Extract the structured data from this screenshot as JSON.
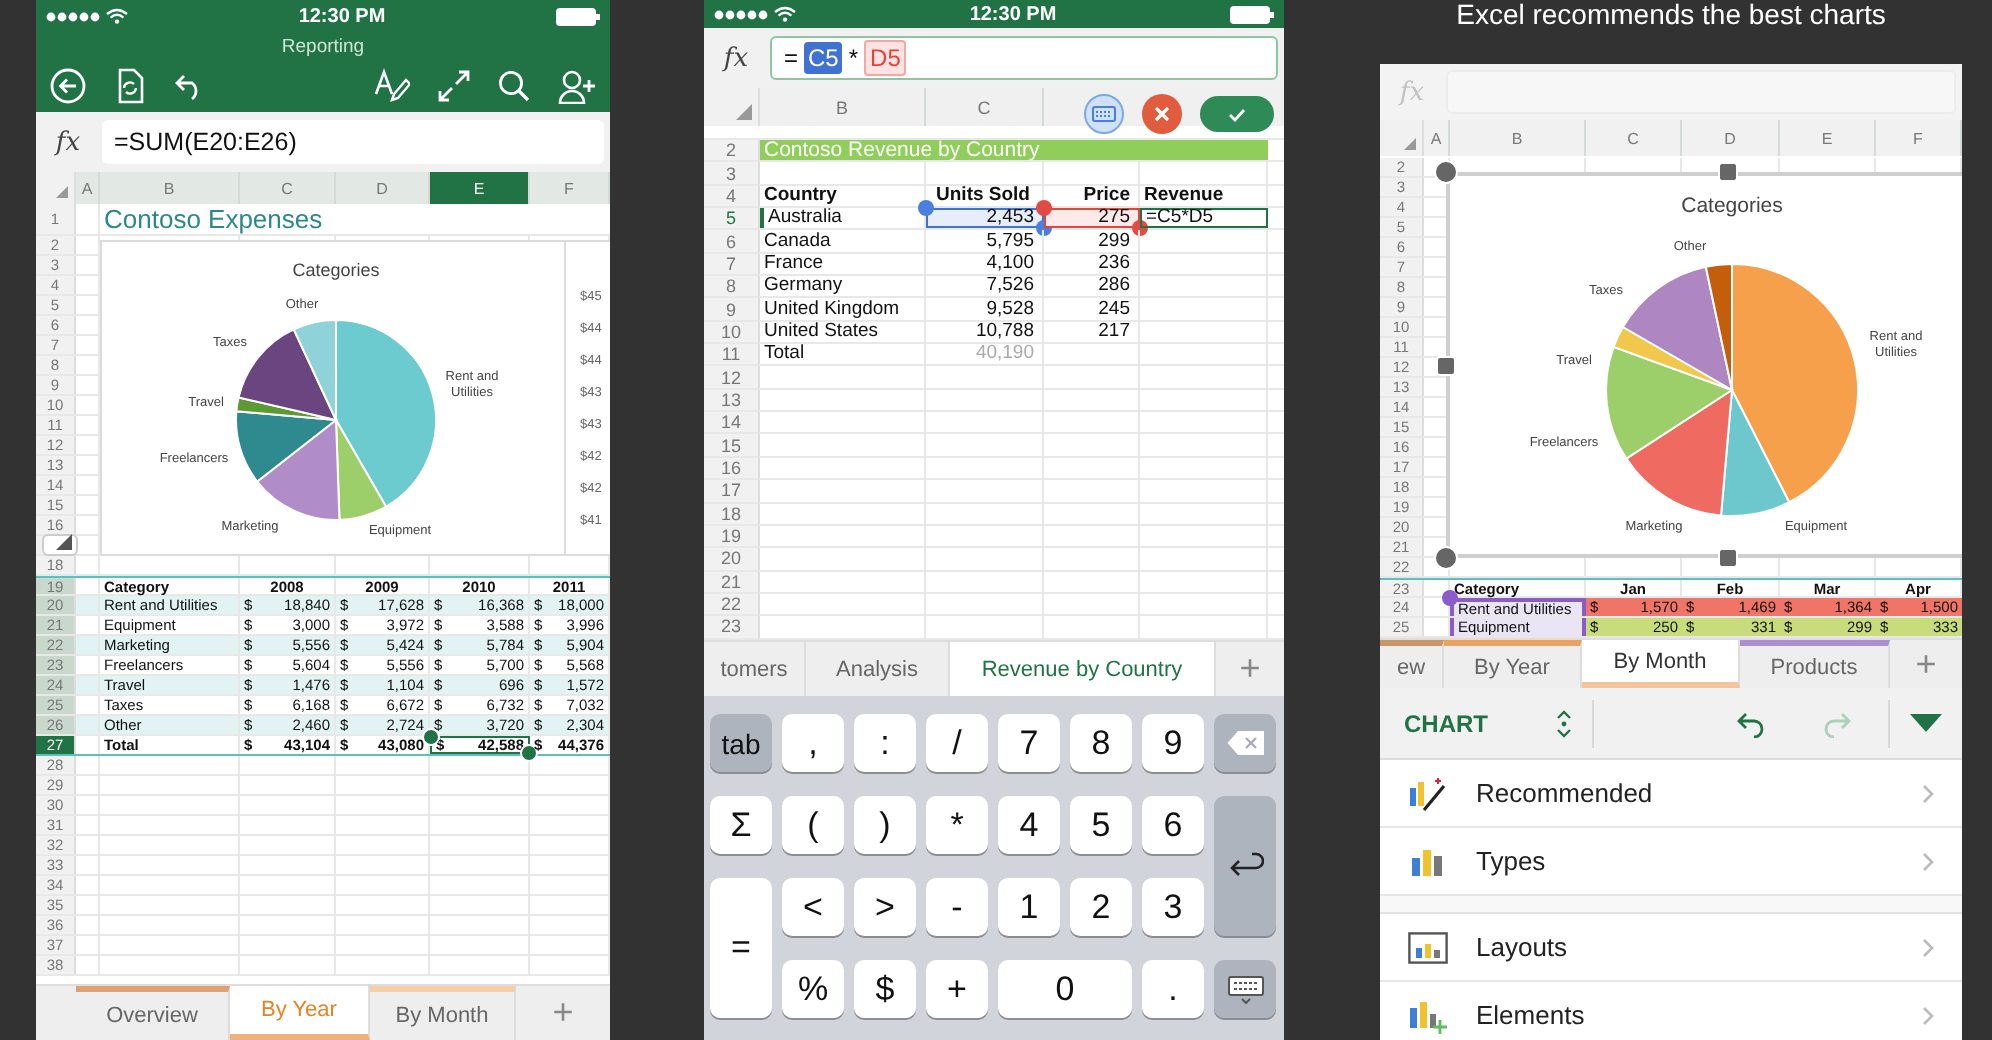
{
  "reporting": {
    "status_bar": {
      "time": "12:30 PM"
    },
    "title": "Reporting",
    "formula_bar": {
      "label": "fx",
      "value": "=SUM(E20:E26)"
    },
    "columns": [
      {
        "label": "A",
        "selected": false
      },
      {
        "label": "B",
        "selected": false
      },
      {
        "label": "C",
        "selected": false
      },
      {
        "label": "D",
        "selected": false
      },
      {
        "label": "E",
        "selected": true
      },
      {
        "label": "F",
        "selected": false
      }
    ],
    "rows": [
      {
        "number": "1",
        "selected": false,
        "highlighted": false,
        "kind": "title",
        "text": "Contoso Expenses"
      },
      {
        "number": "2",
        "selected": false,
        "highlighted": false,
        "kind": "blank"
      },
      {
        "number": "3",
        "selected": false,
        "highlighted": false,
        "kind": "blank"
      },
      {
        "number": "4",
        "selected": false,
        "highlighted": false,
        "kind": "blank"
      },
      {
        "number": "5",
        "selected": false,
        "highlighted": false,
        "kind": "blank"
      },
      {
        "number": "6",
        "selected": false,
        "highlighted": false,
        "kind": "blank"
      },
      {
        "number": "7",
        "selected": false,
        "highlighted": false,
        "kind": "blank"
      },
      {
        "number": "8",
        "selected": false,
        "highlighted": false,
        "kind": "blank"
      },
      {
        "number": "9",
        "selected": false,
        "highlighted": false,
        "kind": "blank"
      },
      {
        "number": "10",
        "selected": false,
        "highlighted": false,
        "kind": "blank"
      },
      {
        "number": "11",
        "selected": false,
        "highlighted": false,
        "kind": "blank"
      },
      {
        "number": "12",
        "selected": false,
        "highlighted": false,
        "kind": "blank"
      },
      {
        "number": "13",
        "selected": false,
        "highlighted": false,
        "kind": "blank"
      },
      {
        "number": "14",
        "selected": false,
        "highlighted": false,
        "kind": "blank"
      },
      {
        "number": "15",
        "selected": false,
        "highlighted": false,
        "kind": "blank"
      },
      {
        "number": "16",
        "selected": false,
        "highlighted": false,
        "kind": "blank"
      },
      {
        "selected": false,
        "highlighted": false,
        "kind": "blank"
      },
      {
        "number": "18",
        "selected": false,
        "highlighted": false,
        "kind": "blank"
      },
      {
        "number": "19",
        "selected": false,
        "highlighted": true,
        "kind": "header",
        "category": "Category",
        "headings": [
          "2008",
          "2009",
          "2010",
          "2011"
        ]
      },
      {
        "number": "20",
        "selected": false,
        "highlighted": true,
        "kind": "data",
        "category": "Rent and Utilities",
        "values": [
          {
            "sign": "$",
            "amount": "18,840",
            "selected": false
          },
          {
            "sign": "$",
            "amount": "17,628",
            "selected": false
          },
          {
            "sign": "$",
            "amount": "16,368",
            "selected": false
          },
          {
            "sign": "$",
            "amount": "18,000",
            "selected": false
          }
        ]
      },
      {
        "number": "21",
        "selected": false,
        "highlighted": true,
        "kind": "data",
        "category": "Equipment",
        "values": [
          {
            "sign": "$",
            "amount": "3,000",
            "selected": false
          },
          {
            "sign": "$",
            "amount": "3,972",
            "selected": false
          },
          {
            "sign": "$",
            "amount": "3,588",
            "selected": false
          },
          {
            "sign": "$",
            "amount": "3,996",
            "selected": false
          }
        ]
      },
      {
        "number": "22",
        "selected": false,
        "highlighted": true,
        "kind": "data",
        "category": "Marketing",
        "values": [
          {
            "sign": "$",
            "amount": "5,556",
            "selected": false
          },
          {
            "sign": "$",
            "amount": "5,424",
            "selected": false
          },
          {
            "sign": "$",
            "amount": "5,784",
            "selected": false
          },
          {
            "sign": "$",
            "amount": "5,904",
            "selected": false
          }
        ]
      },
      {
        "number": "23",
        "selected": false,
        "highlighted": true,
        "kind": "data",
        "category": "Freelancers",
        "values": [
          {
            "sign": "$",
            "amount": "5,604",
            "selected": false
          },
          {
            "sign": "$",
            "amount": "5,556",
            "selected": false
          },
          {
            "sign": "$",
            "amount": "5,700",
            "selected": false
          },
          {
            "sign": "$",
            "amount": "5,568",
            "selected": false
          }
        ]
      },
      {
        "number": "24",
        "selected": false,
        "highlighted": true,
        "kind": "data",
        "category": "Travel",
        "values": [
          {
            "sign": "$",
            "amount": "1,476",
            "selected": false
          },
          {
            "sign": "$",
            "amount": "1,104",
            "selected": false
          },
          {
            "sign": "$",
            "amount": "696",
            "selected": false
          },
          {
            "sign": "$",
            "amount": "1,572",
            "selected": false
          }
        ]
      },
      {
        "number": "25",
        "selected": false,
        "highlighted": true,
        "kind": "data",
        "category": "Taxes",
        "values": [
          {
            "sign": "$",
            "amount": "6,168",
            "selected": false
          },
          {
            "sign": "$",
            "amount": "6,672",
            "selected": false
          },
          {
            "sign": "$",
            "amount": "6,732",
            "selected": false
          },
          {
            "sign": "$",
            "amount": "7,032",
            "selected": false
          }
        ]
      },
      {
        "number": "26",
        "selected": false,
        "highlighted": true,
        "kind": "data",
        "category": "Other",
        "values": [
          {
            "sign": "$",
            "amount": "2,460",
            "selected": false
          },
          {
            "sign": "$",
            "amount": "2,724",
            "selected": false
          },
          {
            "sign": "$",
            "amount": "3,720",
            "selected": false
          },
          {
            "sign": "$",
            "amount": "2,304",
            "selected": false
          }
        ]
      },
      {
        "number": "27",
        "selected": true,
        "highlighted": false,
        "kind": "total",
        "category": "Total",
        "values": [
          {
            "sign": "$",
            "amount": "43,104",
            "selected": false
          },
          {
            "sign": "$",
            "amount": "43,080",
            "selected": false
          },
          {
            "sign": "$",
            "amount": "42,588",
            "selected": true
          },
          {
            "sign": "$",
            "amount": "44,376",
            "selected": false
          }
        ]
      },
      {
        "number": "28",
        "selected": false,
        "highlighted": false,
        "kind": "blank"
      },
      {
        "number": "29",
        "selected": false,
        "highlighted": false,
        "kind": "blank"
      },
      {
        "number": "30",
        "selected": false,
        "highlighted": false,
        "kind": "blank"
      },
      {
        "number": "31",
        "selected": false,
        "highlighted": false,
        "kind": "blank"
      },
      {
        "number": "32",
        "selected": false,
        "highlighted": false,
        "kind": "blank"
      },
      {
        "number": "33",
        "selected": false,
        "highlighted": false,
        "kind": "blank"
      },
      {
        "number": "34",
        "selected": false,
        "highlighted": false,
        "kind": "blank"
      },
      {
        "number": "35",
        "selected": false,
        "highlighted": false,
        "kind": "blank"
      },
      {
        "number": "36",
        "selected": false,
        "highlighted": false,
        "kind": "blank"
      },
      {
        "number": "37",
        "selected": false,
        "highlighted": false,
        "kind": "blank"
      },
      {
        "number": "38",
        "selected": false,
        "highlighted": false,
        "kind": "blank"
      }
    ],
    "chart": {
      "title": "Categories",
      "slices": [
        {
          "label": "Rent and Utilities",
          "color": "#6ccbcf"
        },
        {
          "label": "Equipment",
          "color": "#9ccf6a"
        },
        {
          "label": "Marketing",
          "color": "#b08cc8"
        },
        {
          "label": "Freelancers",
          "color": "#2e8a8f"
        },
        {
          "label": "Travel",
          "color": "#5c9a35"
        },
        {
          "label": "Taxes",
          "color": "#6a4580"
        },
        {
          "label": "Other",
          "color": "#8fd3d8"
        }
      ]
    },
    "side_chart": {
      "labels": [
        "$45",
        "$44",
        "$44",
        "$43",
        "$43",
        "$42",
        "$42",
        "$41"
      ]
    },
    "tabs": [
      {
        "label": "Overview",
        "selected": false,
        "color": "#e0a070"
      },
      {
        "label": "By Year",
        "selected": true,
        "color": "#f0b27c"
      },
      {
        "label": "By Month",
        "selected": false,
        "color": "#f6cfa8"
      }
    ],
    "add_tab": "+"
  },
  "formula_entry": {
    "status_bar": {
      "time": "12:30 PM"
    },
    "formula_bar": {
      "label": "fx",
      "formula": [
        {
          "text": "=",
          "kind": "plain"
        },
        {
          "text": "C5",
          "kind": "ref1"
        },
        {
          "text": "*",
          "kind": "plain"
        },
        {
          "text": "D5",
          "kind": "ref2"
        }
      ]
    },
    "columns": [
      "B",
      "C"
    ],
    "rows": [
      {
        "number": "2",
        "selected": false,
        "kind": "title",
        "cells": [
          "Contoso Revenue by Country"
        ]
      },
      {
        "number": "3",
        "selected": false,
        "kind": "blank"
      },
      {
        "number": "4",
        "selected": false,
        "kind": "header",
        "cells": [
          "Country",
          "Units Sold",
          "Price",
          "Revenue"
        ]
      },
      {
        "number": "5",
        "selected": true,
        "kind": "editing",
        "cells": [
          "Australia",
          "2,453",
          "275",
          "=C5*D5"
        ]
      },
      {
        "number": "6",
        "selected": false,
        "kind": "data",
        "cells": [
          "Canada",
          "5,795",
          "299"
        ]
      },
      {
        "number": "7",
        "selected": false,
        "kind": "data",
        "cells": [
          "France",
          "4,100",
          "236"
        ]
      },
      {
        "number": "8",
        "selected": false,
        "kind": "data",
        "cells": [
          "Germany",
          "7,526",
          "286"
        ]
      },
      {
        "number": "9",
        "selected": false,
        "kind": "data",
        "cells": [
          "United Kingdom",
          "9,528",
          "245"
        ]
      },
      {
        "number": "10",
        "selected": false,
        "kind": "data",
        "cells": [
          "United States",
          "10,788",
          "217"
        ]
      },
      {
        "number": "11",
        "selected": false,
        "kind": "total",
        "cells": [
          "Total",
          "40,190"
        ]
      },
      {
        "number": "12",
        "selected": false,
        "kind": "blank"
      },
      {
        "number": "13",
        "selected": false,
        "kind": "blank"
      },
      {
        "number": "14",
        "selected": false,
        "kind": "blank"
      },
      {
        "number": "15",
        "selected": false,
        "kind": "blank"
      },
      {
        "number": "16",
        "selected": false,
        "kind": "blank"
      },
      {
        "number": "17",
        "selected": false,
        "kind": "blank"
      },
      {
        "number": "18",
        "selected": false,
        "kind": "blank"
      },
      {
        "number": "19",
        "selected": false,
        "kind": "blank"
      },
      {
        "number": "20",
        "selected": false,
        "kind": "blank"
      },
      {
        "number": "21",
        "selected": false,
        "kind": "blank"
      },
      {
        "number": "22",
        "selected": false,
        "kind": "blank"
      },
      {
        "number": "23",
        "selected": false,
        "kind": "blank"
      }
    ],
    "tabs": [
      {
        "label": "tomers",
        "selected": false
      },
      {
        "label": "Analysis",
        "selected": false
      },
      {
        "label": "Revenue by Country",
        "selected": true
      }
    ],
    "add_tab": "+",
    "keys": [
      {
        "label": "tab",
        "kind": "tab"
      },
      {
        "label": ",",
        "kind": "key"
      },
      {
        "label": ":",
        "kind": "key"
      },
      {
        "label": "/",
        "kind": "key"
      },
      {
        "label": "7",
        "kind": "key"
      },
      {
        "label": "8",
        "kind": "key"
      },
      {
        "label": "9",
        "kind": "key"
      },
      {
        "kind": "delete"
      },
      {
        "label": "Σ",
        "kind": "key"
      },
      {
        "label": "(",
        "kind": "key"
      },
      {
        "label": ")",
        "kind": "key"
      },
      {
        "label": "*",
        "kind": "key"
      },
      {
        "label": "4",
        "kind": "key"
      },
      {
        "label": "5",
        "kind": "key"
      },
      {
        "label": "6",
        "kind": "key"
      },
      {
        "kind": "return"
      },
      {
        "label": "=",
        "kind": "tall"
      },
      {
        "label": "<",
        "kind": "key"
      },
      {
        "label": ">",
        "kind": "key"
      },
      {
        "label": "-",
        "kind": "key"
      },
      {
        "label": "1",
        "kind": "key"
      },
      {
        "label": "2",
        "kind": "key"
      },
      {
        "label": "3",
        "kind": "key"
      },
      {
        "label": "%",
        "kind": "key"
      },
      {
        "label": "$",
        "kind": "key"
      },
      {
        "label": "+",
        "kind": "key"
      },
      {
        "label": "0",
        "kind": "wide"
      },
      {
        "label": ".",
        "kind": "key"
      },
      {
        "kind": "hide"
      }
    ]
  },
  "chart_screen": {
    "caption": "Excel recommends the best charts",
    "formula_bar": {
      "label": "fx",
      "disabled": true
    },
    "columns": [
      "A",
      "B",
      "C",
      "D",
      "E",
      "F"
    ],
    "rows": [
      {
        "number": "2",
        "kind": "blank"
      },
      {
        "number": "3",
        "kind": "blank"
      },
      {
        "number": "4",
        "kind": "blank"
      },
      {
        "number": "5",
        "kind": "blank"
      },
      {
        "number": "6",
        "kind": "blank"
      },
      {
        "number": "7",
        "kind": "blank"
      },
      {
        "number": "8",
        "kind": "blank"
      },
      {
        "number": "9",
        "kind": "blank"
      },
      {
        "number": "10",
        "kind": "blank"
      },
      {
        "number": "11",
        "kind": "blank"
      },
      {
        "number": "12",
        "kind": "blank"
      },
      {
        "number": "13",
        "kind": "blank"
      },
      {
        "number": "14",
        "kind": "blank"
      },
      {
        "number": "15",
        "kind": "blank"
      },
      {
        "number": "16",
        "kind": "blank"
      },
      {
        "number": "17",
        "kind": "blank"
      },
      {
        "number": "18",
        "kind": "blank"
      },
      {
        "number": "19",
        "kind": "blank"
      },
      {
        "number": "20",
        "kind": "blank"
      },
      {
        "number": "21",
        "kind": "blank"
      },
      {
        "number": "22",
        "kind": "blank"
      },
      {
        "number": "23",
        "kind": "header",
        "category": "Category",
        "headings": [
          "Jan",
          "Feb",
          "Mar",
          "Apr"
        ]
      },
      {
        "number": "24",
        "kind": "data",
        "category": "Rent and Utilities",
        "selected": true,
        "color": "#f07468",
        "values": [
          {
            "sign": "$",
            "amount": "1,570"
          },
          {
            "sign": "$",
            "amount": "1,469"
          },
          {
            "sign": "$",
            "amount": "1,364"
          },
          {
            "sign": "$",
            "amount": "1,500"
          }
        ]
      },
      {
        "number": "25",
        "kind": "data",
        "category": "Equipment",
        "selected": true,
        "color": "#c9dc7c",
        "values": [
          {
            "sign": "$",
            "amount": "250"
          },
          {
            "sign": "$",
            "amount": "331"
          },
          {
            "sign": "$",
            "amount": "299"
          },
          {
            "sign": "$",
            "amount": "333"
          }
        ]
      }
    ],
    "chart": {
      "title": "Categories",
      "slices": [
        {
          "label": "Rent and Utilities",
          "color": "#f7a04b"
        },
        {
          "label": "Equipment",
          "color": "#6cc8cc"
        },
        {
          "label": "Marketing",
          "color": "#ef6b62"
        },
        {
          "label": "Freelancers",
          "color": "#9ccf6a"
        },
        {
          "label": "Travel",
          "color": "#f1c84c"
        },
        {
          "label": "Taxes",
          "color": "#ad86c2"
        },
        {
          "label": "Other",
          "color": "#c45e0a"
        }
      ]
    },
    "tabs": [
      {
        "label": "ew",
        "selected": false,
        "color": "#c8966a"
      },
      {
        "label": "By Year",
        "selected": false,
        "color": "#e9a262"
      },
      {
        "label": "By Month",
        "selected": true,
        "color": "#f5c49a"
      },
      {
        "label": "Products",
        "selected": false,
        "color": "#ad8fcf"
      }
    ],
    "add_tab": "+",
    "toolbar": {
      "label": "CHART",
      "actions": [
        {
          "kind": "undo",
          "disabled": false
        },
        {
          "kind": "redo",
          "disabled": true
        }
      ]
    },
    "sections": [
      [
        {
          "label": "Recommended",
          "kind": "recommended"
        },
        {
          "label": "Types",
          "kind": "types"
        }
      ],
      [
        {
          "label": "Layouts",
          "kind": "layouts"
        },
        {
          "label": "Elements",
          "kind": "elements"
        }
      ]
    ]
  }
}
